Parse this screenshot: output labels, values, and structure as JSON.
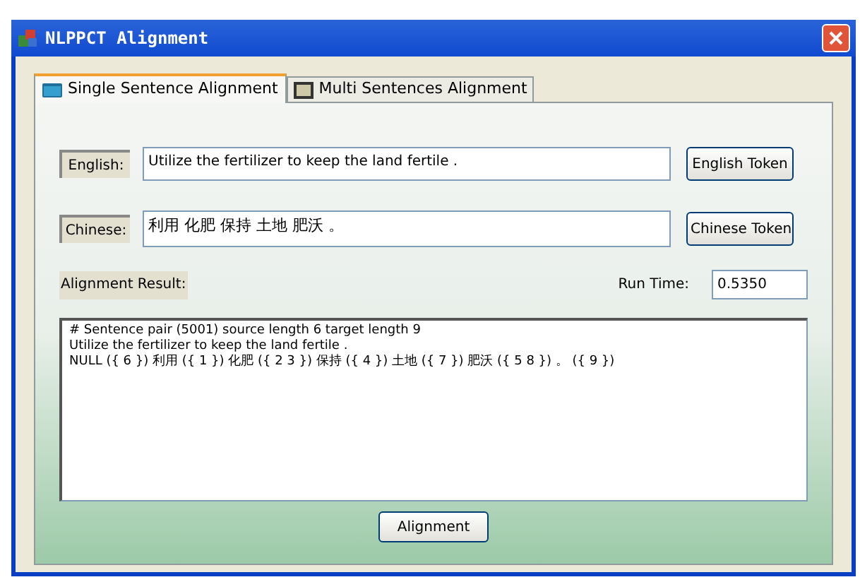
{
  "window": {
    "title": "NLPPCT Alignment"
  },
  "tabs": [
    {
      "label": "Single Sentence Alignment",
      "selected": true
    },
    {
      "label": "Multi Sentences Alignment",
      "selected": false
    }
  ],
  "english": {
    "label": "English:",
    "value": "Utilize the fertilizer to keep the land fertile .",
    "button": "English Token"
  },
  "chinese": {
    "label": "Chinese:",
    "value": "利用 化肥 保持 土地 肥沃 。",
    "button": "Chinese Token"
  },
  "result": {
    "label": "Alignment Result:",
    "run_time_label": "Run Time:",
    "run_time": "0.5350",
    "lines": [
      "# Sentence pair (5001) source length 6 target length 9",
      "Utilize the fertilizer to keep the land fertile .",
      "NULL ({ 6 }) 利用 ({ 1 }) 化肥 ({ 2 3 }) 保持 ({ 4 }) 土地 ({ 7 }) 肥沃 ({ 5 8 }) 。 ({ 9 })"
    ]
  },
  "button": "Alignment"
}
